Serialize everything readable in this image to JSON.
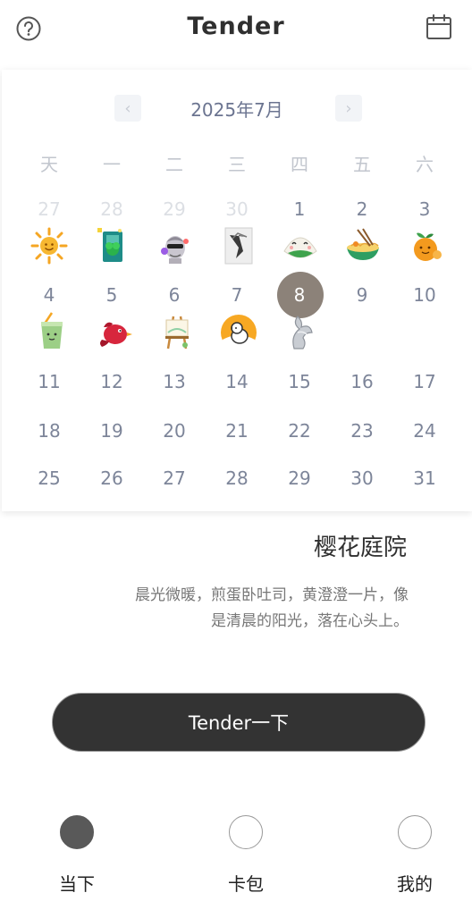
{
  "header": {
    "title": "Tender",
    "help_icon": "help-circle-icon",
    "calendar_icon": "calendar-icon"
  },
  "calendar": {
    "month_label": "2025年7月",
    "weekdays": [
      "天",
      "一",
      "二",
      "三",
      "四",
      "五",
      "六"
    ],
    "weeks": [
      [
        "27",
        "28",
        "29",
        "30",
        "1",
        "2",
        "3"
      ],
      [
        "4",
        "5",
        "6",
        "7",
        "8",
        "9",
        "10"
      ],
      [
        "11",
        "12",
        "13",
        "14",
        "15",
        "16",
        "17"
      ],
      [
        "18",
        "19",
        "20",
        "21",
        "22",
        "23",
        "24"
      ],
      [
        "25",
        "26",
        "27",
        "28",
        "29",
        "30",
        "31"
      ]
    ],
    "selected_day": "8",
    "stickers": {
      "1": "sun-sticker",
      "2": "plant-card-sticker",
      "3": "statue-sticker",
      "4": "sketch-card-sticker",
      "5": "dumpling-sticker",
      "6": "noodle-bowl-sticker",
      "7": "orange-sticker",
      "8": "drink-cup-sticker",
      "9": "red-bird-sticker",
      "10": "easel-sticker",
      "11": "dog-badge-sticker",
      "12": "silver-sculpture-sticker"
    },
    "colors": {
      "accent": "#8c8279",
      "muted": "#dcdfe4",
      "day_text": "#7d8599"
    }
  },
  "detail": {
    "place": "樱花庭院",
    "line1": "晨光微暖，煎蛋卧吐司，黄澄澄一片，像",
    "line2": "是清晨的阳光，落在心头上。"
  },
  "action": {
    "label": "Tender一下"
  },
  "tabs": [
    {
      "label": "当下",
      "active": true
    },
    {
      "label": "卡包",
      "active": false
    },
    {
      "label": "我的",
      "active": false
    }
  ]
}
